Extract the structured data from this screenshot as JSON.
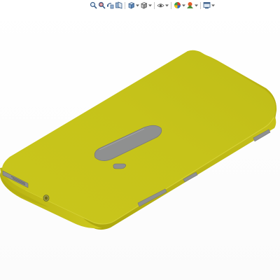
{
  "viewport": {
    "background": "#ffffff"
  },
  "heads_up_toolbar": {
    "buttons": [
      {
        "icon": "zoom-to-fit-icon"
      },
      {
        "icon": "zoom-to-area-icon"
      },
      {
        "icon": "previous-view-icon"
      },
      {
        "icon": "section-view-icon"
      },
      {
        "icon": "view-orientation-icon",
        "has_dropdown": true
      },
      {
        "icon": "display-style-icon",
        "has_dropdown": true
      },
      {
        "icon": "hide-show-items-icon",
        "has_dropdown": true
      },
      {
        "icon": "edit-appearance-icon",
        "has_dropdown": true
      },
      {
        "icon": "apply-scene-icon",
        "has_dropdown": true
      },
      {
        "icon": "view-settings-icon",
        "has_dropdown": true
      }
    ]
  },
  "model": {
    "name": "phone-body",
    "body_color": "#c4c21a",
    "edge_color": "#b2ac0e",
    "feature_color": "#8f9090"
  }
}
